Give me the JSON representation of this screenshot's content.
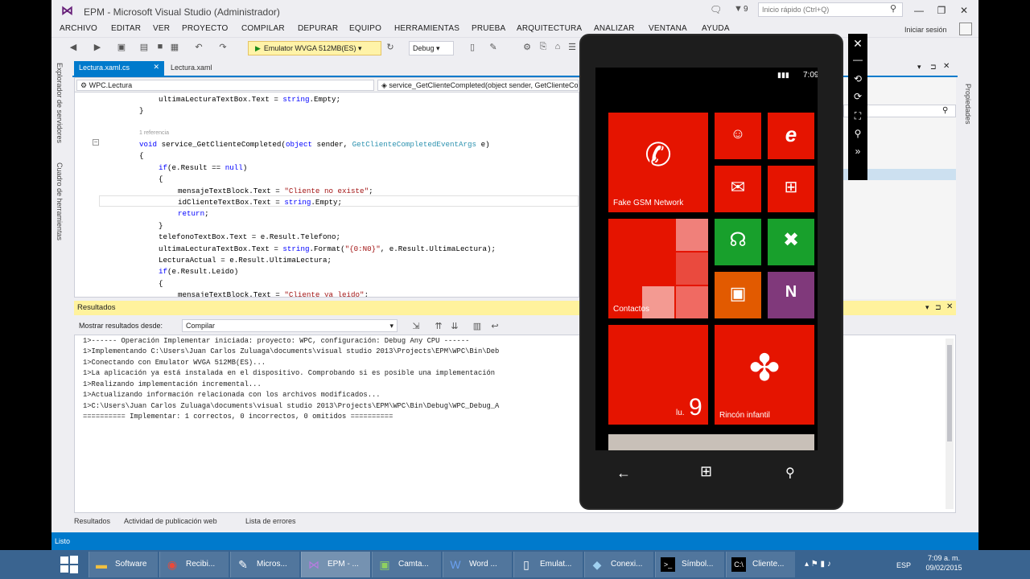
{
  "window": {
    "title": "EPM - Microsoft Visual Studio (Administrador)",
    "quick_launch_placeholder": "Inicio rápido (Ctrl+Q)",
    "filter_count": "9",
    "sign_in": "Iniciar sesión"
  },
  "menu": [
    "ARCHIVO",
    "EDITAR",
    "VER",
    "PROYECTO",
    "COMPILAR",
    "DEPURAR",
    "EQUIPO",
    "HERRAMIENTAS",
    "PRUEBA",
    "ARQUITECTURA",
    "ANALIZAR",
    "VENTANA",
    "AYUDA"
  ],
  "toolbar": {
    "run_target": "Emulator WVGA 512MB(ES)",
    "configuration": "Debug"
  },
  "sidebar_left": [
    "Explorador de servidores",
    "Cuadro de herramientas"
  ],
  "sidebar_right": [
    "Propiedades"
  ],
  "tabs": [
    {
      "label": "Lectura.xaml.cs",
      "active": true
    },
    {
      "label": "Lectura.xaml",
      "active": false
    }
  ],
  "editor": {
    "nav_class": "WPC.Lectura",
    "nav_member": "service_GetClienteCompleted(object sender, GetClienteCompletedEventArgs e)",
    "code": {
      "l1a": "ultimaLecturaTextBox.Text = ",
      "l1b": "string",
      "l1c": ".Empty;",
      "l2": "}",
      "ref": "1 referencia",
      "l3a": "void",
      "l3b": " service_GetClienteCompleted(",
      "l3c": "object",
      "l3d": " sender, ",
      "l3e": "GetClienteCompletedEventArgs",
      "l3f": " e)",
      "l4": "{",
      "l5a": "if",
      "l5b": "(e.Result == ",
      "l5c": "null",
      "l5d": ")",
      "l6": "{",
      "l7a": "mensajeTextBlock.Text = ",
      "l7b": "\"Cliente no existe\"",
      "l7c": ";",
      "l8a": "idClienteTextBox.Text = ",
      "l8b": "string",
      "l8c": ".Empty;",
      "l9a": "return",
      "l9b": ";",
      "l10": "}",
      "l11": "telefonoTextBox.Text = e.Result.Telefono;",
      "l12a": "ultimaLecturaTextBox.Text = ",
      "l12b": "string",
      "l12c": ".Format(",
      "l12d": "\"{0:N0}\"",
      "l12e": ", e.Result.UltimaLectura);",
      "l13": "LecturaActual = e.Result.UltimaLectura;",
      "l14a": "if",
      "l14b": "(e.Result.Leido)",
      "l15": "{",
      "l16a": "mensajeTextBlock.Text = ",
      "l16b": "\"Cliente ya leido\"",
      "l16c": ";"
    }
  },
  "output": {
    "title": "Resultados",
    "show_from_label": "Mostrar resultados desde:",
    "source": "Compilar",
    "lines": [
      "1>------ Operación Implementar iniciada: proyecto: WPC, configuración: Debug Any CPU ------",
      "1>Implementando C:\\Users\\Juan Carlos Zuluaga\\documents\\visual studio 2013\\Projects\\EPM\\WPC\\Bin\\Deb",
      "1>Conectando con Emulator WVGA 512MB(ES)...",
      "1>La aplicación ya está instalada en el dispositivo. Comprobando si es posible una implementación",
      "1>Realizando implementación incremental...",
      "1>Actualizando información relacionada con los archivos modificados...",
      "1>C:\\Users\\Juan Carlos Zuluaga\\documents\\visual studio 2013\\Projects\\EPM\\WPC\\Bin\\Debug\\WPC_Debug_A",
      "========== Implementar: 1 correctos, 0 incorrectos, 0 omitidos =========="
    ]
  },
  "bottom_tabs": [
    "Resultados",
    "Actividad de publicación web",
    "Lista de errores"
  ],
  "status": "Listo",
  "phone": {
    "time": "7:09",
    "tiles": {
      "phone_label": "Fake GSM Network",
      "contacts_label": "Contactos",
      "calendar_day": "lu.",
      "calendar_date": "9",
      "kids_label": "Rincón infantil"
    }
  },
  "taskbar": {
    "items": [
      "Software",
      "Recibi...",
      "Micros...",
      "EPM - ...",
      "Camta...",
      "Word ...",
      "Emulat...",
      "Conexi...",
      "Símbol...",
      "Cliente..."
    ],
    "lang": "ESP",
    "time": "7:09 a. m.",
    "date": "09/02/2015"
  },
  "colors": {
    "accent": "#007acc",
    "tile_red": "#e51400",
    "tile_green": "#18a02c",
    "tile_orange": "#e25a00",
    "tile_purple": "#80397b"
  }
}
